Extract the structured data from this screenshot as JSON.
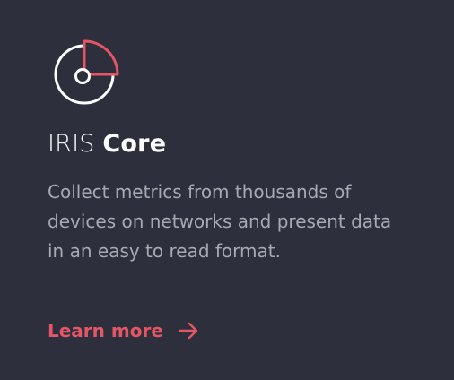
{
  "card": {
    "icon": "radar-chart-icon",
    "title_light": "IRIS",
    "title_bold": "Core",
    "description": "Collect metrics from thousands of devices on networks and present data in an easy to read format.",
    "link_label": "Learn more",
    "link_icon": "arrow-right-icon"
  },
  "colors": {
    "background": "#2d303c",
    "accent": "#e25665",
    "title": "#ffffff",
    "body_text": "#a8aab3"
  }
}
